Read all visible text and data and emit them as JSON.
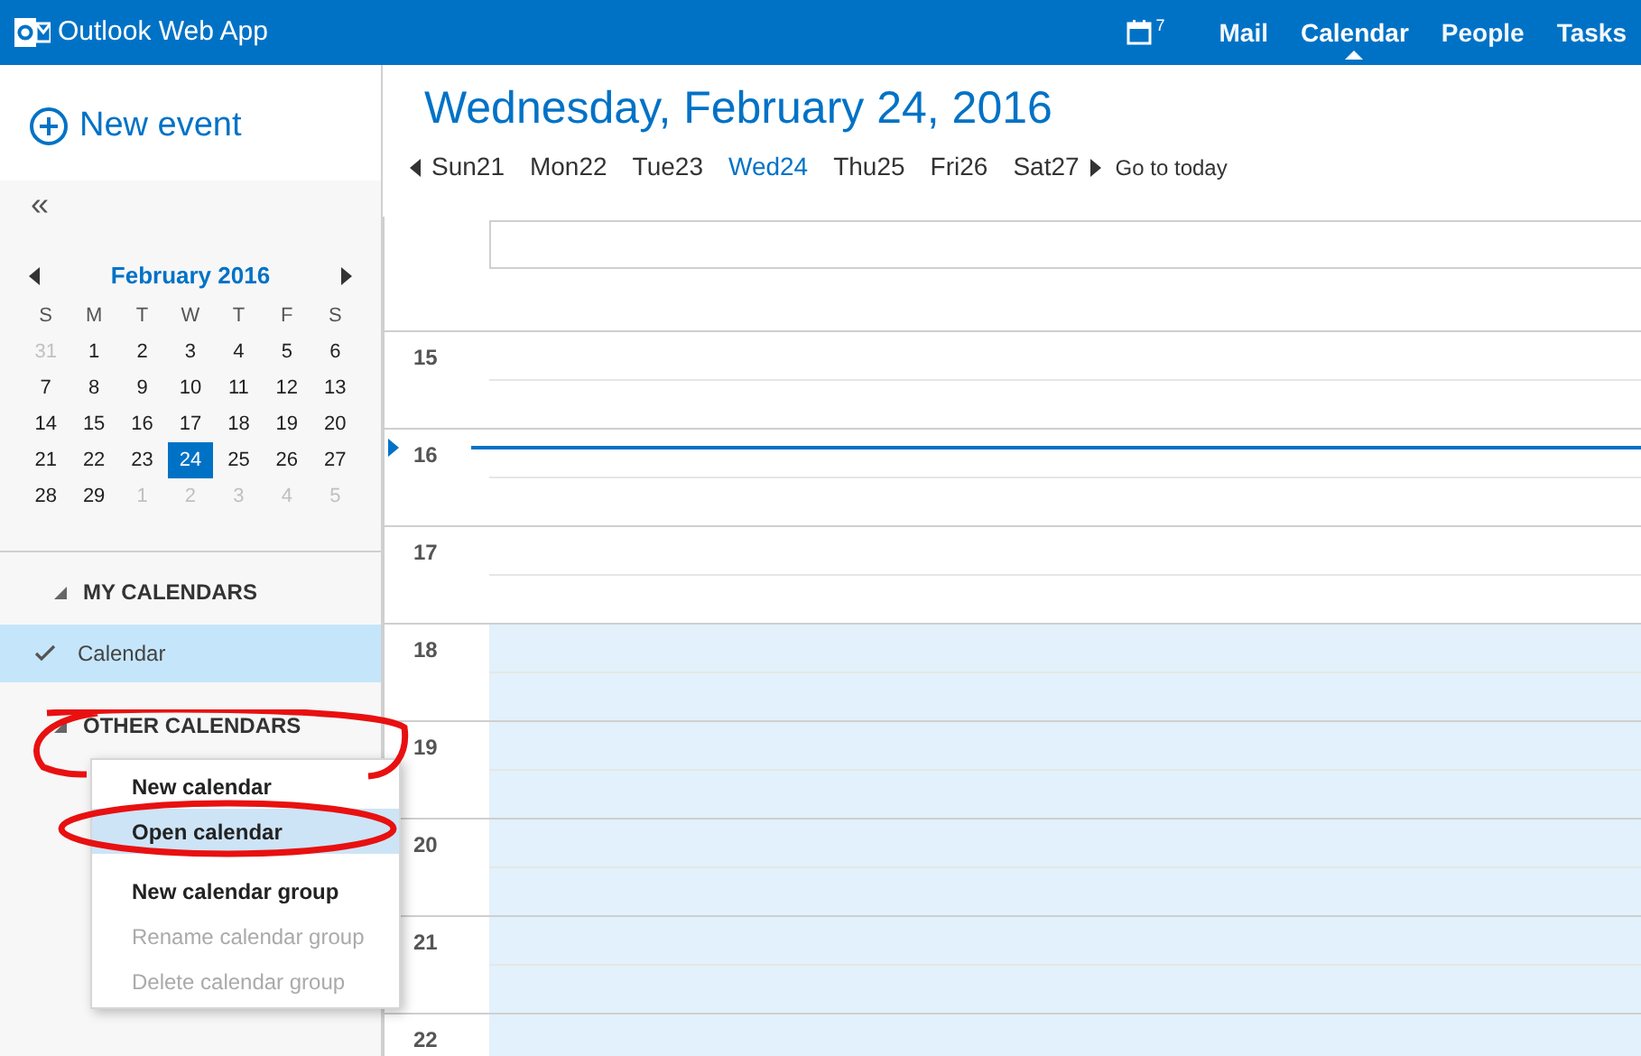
{
  "app": {
    "title": "Outlook Web App"
  },
  "nav": {
    "calendar_badge": "7",
    "items": [
      {
        "label": "Mail",
        "selected": false
      },
      {
        "label": "Calendar",
        "selected": true
      },
      {
        "label": "People",
        "selected": false
      },
      {
        "label": "Tasks",
        "selected": false
      }
    ]
  },
  "sidebar": {
    "new_event": "New event",
    "collapse": "«",
    "mini_calendar": {
      "title": "February 2016",
      "weekdays": [
        "S",
        "M",
        "T",
        "W",
        "T",
        "F",
        "S"
      ],
      "days": [
        {
          "label": "31",
          "muted": true,
          "selected": false
        },
        {
          "label": "1",
          "muted": false,
          "selected": false
        },
        {
          "label": "2",
          "muted": false,
          "selected": false
        },
        {
          "label": "3",
          "muted": false,
          "selected": false
        },
        {
          "label": "4",
          "muted": false,
          "selected": false
        },
        {
          "label": "5",
          "muted": false,
          "selected": false
        },
        {
          "label": "6",
          "muted": false,
          "selected": false
        },
        {
          "label": "7",
          "muted": false,
          "selected": false
        },
        {
          "label": "8",
          "muted": false,
          "selected": false
        },
        {
          "label": "9",
          "muted": false,
          "selected": false
        },
        {
          "label": "10",
          "muted": false,
          "selected": false
        },
        {
          "label": "11",
          "muted": false,
          "selected": false
        },
        {
          "label": "12",
          "muted": false,
          "selected": false
        },
        {
          "label": "13",
          "muted": false,
          "selected": false
        },
        {
          "label": "14",
          "muted": false,
          "selected": false
        },
        {
          "label": "15",
          "muted": false,
          "selected": false
        },
        {
          "label": "16",
          "muted": false,
          "selected": false
        },
        {
          "label": "17",
          "muted": false,
          "selected": false
        },
        {
          "label": "18",
          "muted": false,
          "selected": false
        },
        {
          "label": "19",
          "muted": false,
          "selected": false
        },
        {
          "label": "20",
          "muted": false,
          "selected": false
        },
        {
          "label": "21",
          "muted": false,
          "selected": false
        },
        {
          "label": "22",
          "muted": false,
          "selected": false
        },
        {
          "label": "23",
          "muted": false,
          "selected": false
        },
        {
          "label": "24",
          "muted": false,
          "selected": true
        },
        {
          "label": "25",
          "muted": false,
          "selected": false
        },
        {
          "label": "26",
          "muted": false,
          "selected": false
        },
        {
          "label": "27",
          "muted": false,
          "selected": false
        },
        {
          "label": "28",
          "muted": false,
          "selected": false
        },
        {
          "label": "29",
          "muted": false,
          "selected": false
        },
        {
          "label": "1",
          "muted": true,
          "selected": false
        },
        {
          "label": "2",
          "muted": true,
          "selected": false
        },
        {
          "label": "3",
          "muted": true,
          "selected": false
        },
        {
          "label": "4",
          "muted": true,
          "selected": false
        },
        {
          "label": "5",
          "muted": true,
          "selected": false
        }
      ]
    },
    "groups": [
      {
        "title": "MY CALENDARS",
        "expanded": true,
        "calendars": [
          {
            "label": "Calendar",
            "checked": true,
            "selected": true
          }
        ]
      },
      {
        "title": "OTHER CALENDARS",
        "expanded": true
      }
    ]
  },
  "context_menu": {
    "items": [
      {
        "label": "New calendar",
        "disabled": false,
        "selected": false,
        "separator_after": false
      },
      {
        "label": "Open calendar",
        "disabled": false,
        "selected": true,
        "separator_after": true
      },
      {
        "label": "New calendar group",
        "disabled": false,
        "selected": false,
        "separator_after": false
      },
      {
        "label": "Rename calendar group",
        "disabled": true,
        "selected": false,
        "separator_after": false
      },
      {
        "label": "Delete calendar group",
        "disabled": true,
        "selected": false,
        "separator_after": false
      }
    ]
  },
  "day_view": {
    "title": "Wednesday, February 24, 2016",
    "days": [
      {
        "label": "Sun21",
        "selected": false
      },
      {
        "label": "Mon22",
        "selected": false
      },
      {
        "label": "Tue23",
        "selected": false
      },
      {
        "label": "Wed24",
        "selected": true
      },
      {
        "label": "Thu25",
        "selected": false
      },
      {
        "label": "Fri26",
        "selected": false
      },
      {
        "label": "Sat27",
        "selected": false
      }
    ],
    "go_to_today": "Go to today",
    "hours": [
      {
        "label": "15",
        "shaded": false,
        "now": false
      },
      {
        "label": "16",
        "shaded": false,
        "now": true
      },
      {
        "label": "17",
        "shaded": false,
        "now": false
      },
      {
        "label": "18",
        "shaded": true,
        "now": false
      },
      {
        "label": "19",
        "shaded": true,
        "now": false
      },
      {
        "label": "20",
        "shaded": true,
        "now": false
      },
      {
        "label": "21",
        "shaded": true,
        "now": false
      },
      {
        "label": "22",
        "shaded": true,
        "now": false
      }
    ]
  }
}
